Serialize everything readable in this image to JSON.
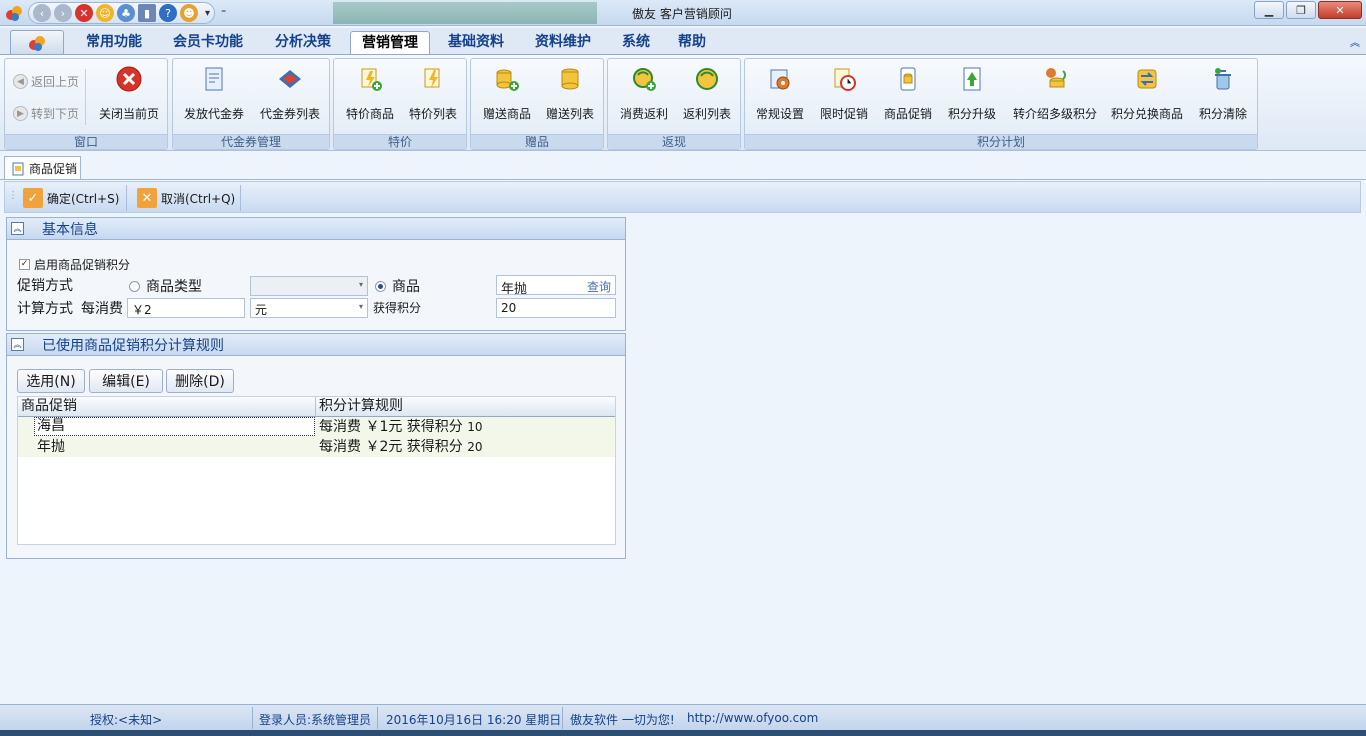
{
  "window": {
    "title": "傲友 客户营销顾问"
  },
  "menu": {
    "tabs": [
      "常用功能",
      "会员卡功能",
      "分析决策",
      "营销管理",
      "基础资料",
      "资料维护",
      "系统",
      "帮助"
    ],
    "active": "营销管理"
  },
  "ribbon": {
    "window_group": {
      "label": "窗口",
      "back": "返回上页",
      "forward": "转到下页",
      "close": "关闭当前页"
    },
    "voucher_group": {
      "label": "代金券管理",
      "issue": "发放代金券",
      "list": "代金券列表"
    },
    "special_group": {
      "label": "特价",
      "goods": "特价商品",
      "list": "特价列表"
    },
    "gift_group": {
      "label": "赠品",
      "goods": "赠送商品",
      "list": "赠送列表"
    },
    "rebate_group": {
      "label": "返现",
      "consume": "消费返利",
      "list": "返利列表"
    },
    "points_group": {
      "label": "积分计划",
      "regular": "常规设置",
      "timed": "限时促销",
      "goods": "商品促销",
      "upgrade": "积分升级",
      "referral": "转介绍多级积分",
      "exchange": "积分兑换商品",
      "clear": "积分清除"
    }
  },
  "doc_tab": {
    "label": "商品促销"
  },
  "toolbar": {
    "confirm": "确定(Ctrl+S)",
    "cancel": "取消(Ctrl+Q)"
  },
  "basic": {
    "title": "基本信息",
    "enable_label": "启用商品促销积分",
    "enable_checked": true,
    "mode_label": "促销方式",
    "option_type": "商品类型",
    "option_goods": "商品",
    "goods_value": "年抛",
    "query_label": "查询",
    "calc_label": "计算方式",
    "per_label": "每消费",
    "amount_value": "￥2",
    "unit_value": "元",
    "earn_label": "获得积分",
    "points_value": "20"
  },
  "rules": {
    "title": "已使用商品促销积分计算规则",
    "select_btn": "选用(N)",
    "edit_btn": "编辑(E)",
    "delete_btn": "删除(D)",
    "columns": [
      "商品促销",
      "积分计算规则"
    ],
    "rows": [
      {
        "goods": "海昌",
        "rule": "每消费 ￥1元 获得积分",
        "points": "10"
      },
      {
        "goods": "年抛",
        "rule": "每消费 ￥2元 获得积分",
        "points": "20"
      }
    ]
  },
  "status": {
    "auth": "授权:<未知>",
    "user": "登录人员:系统管理员",
    "datetime": "2016年10月16日 16:20 星期日",
    "slogan": "傲友软件 一切为您!",
    "url": "http://www.ofyoo.com"
  },
  "colors": {
    "accent": "#15428b",
    "ribbon_bg": "#dde8f5",
    "close_red": "#d8332a"
  }
}
